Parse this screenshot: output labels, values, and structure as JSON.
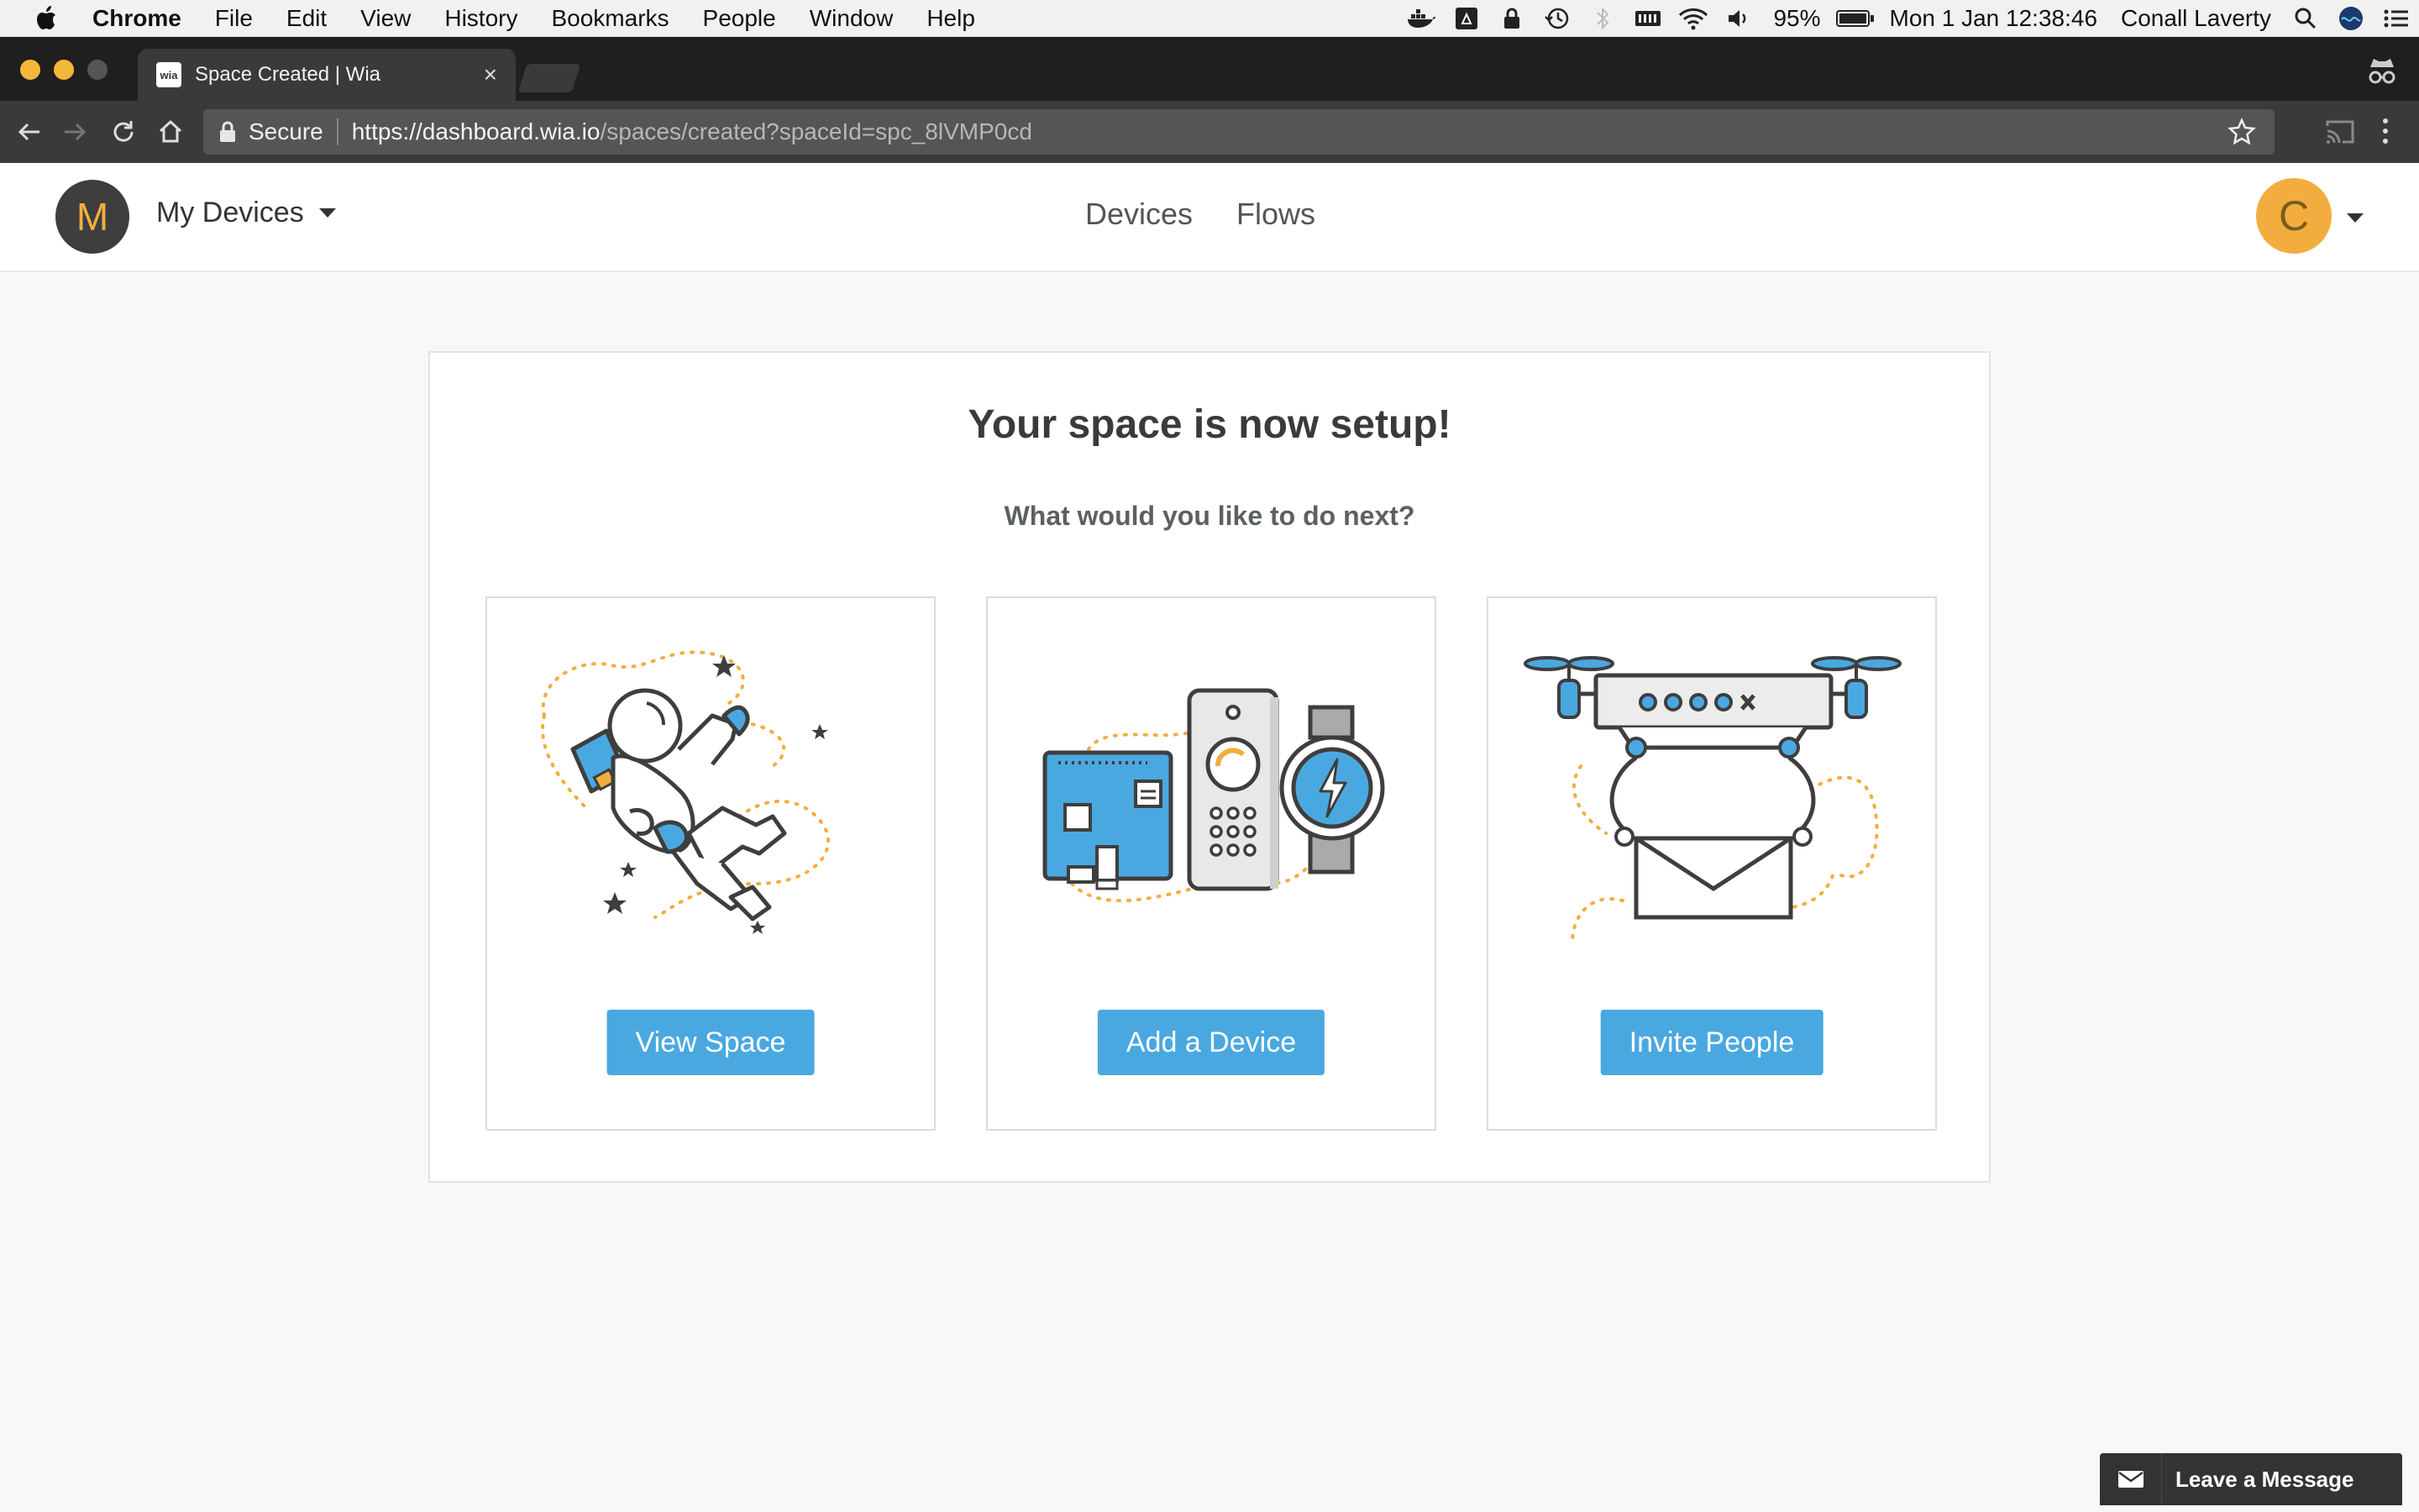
{
  "menubar": {
    "app": "Chrome",
    "items": [
      "File",
      "Edit",
      "View",
      "History",
      "Bookmarks",
      "People",
      "Window",
      "Help"
    ],
    "battery": "95%",
    "datetime": "Mon 1 Jan  12:38:46",
    "user": "Conall Laverty"
  },
  "browser": {
    "tab_title": "Space Created | Wia",
    "favicon_text": "wia",
    "secure_label": "Secure",
    "url_host": "https://dashboard.wia.io",
    "url_path": "/spaces/created?spaceId=spc_8lVMP0cd"
  },
  "header": {
    "space_initial": "M",
    "space_name": "My Devices",
    "nav": [
      "Devices",
      "Flows"
    ],
    "user_initial": "C"
  },
  "main": {
    "title": "Your space is now setup!",
    "subtitle": "What would you like to do next?",
    "cards": [
      {
        "button": "View Space",
        "illustration": "astronaut-illustration"
      },
      {
        "button": "Add a Device",
        "illustration": "devices-illustration"
      },
      {
        "button": "Invite People",
        "illustration": "drone-mail-illustration"
      }
    ]
  },
  "chat": {
    "label": "Leave a Message"
  },
  "colors": {
    "accent": "#4aa8e0",
    "orange": "#f3ad3f",
    "dark": "#3e3e3e"
  }
}
